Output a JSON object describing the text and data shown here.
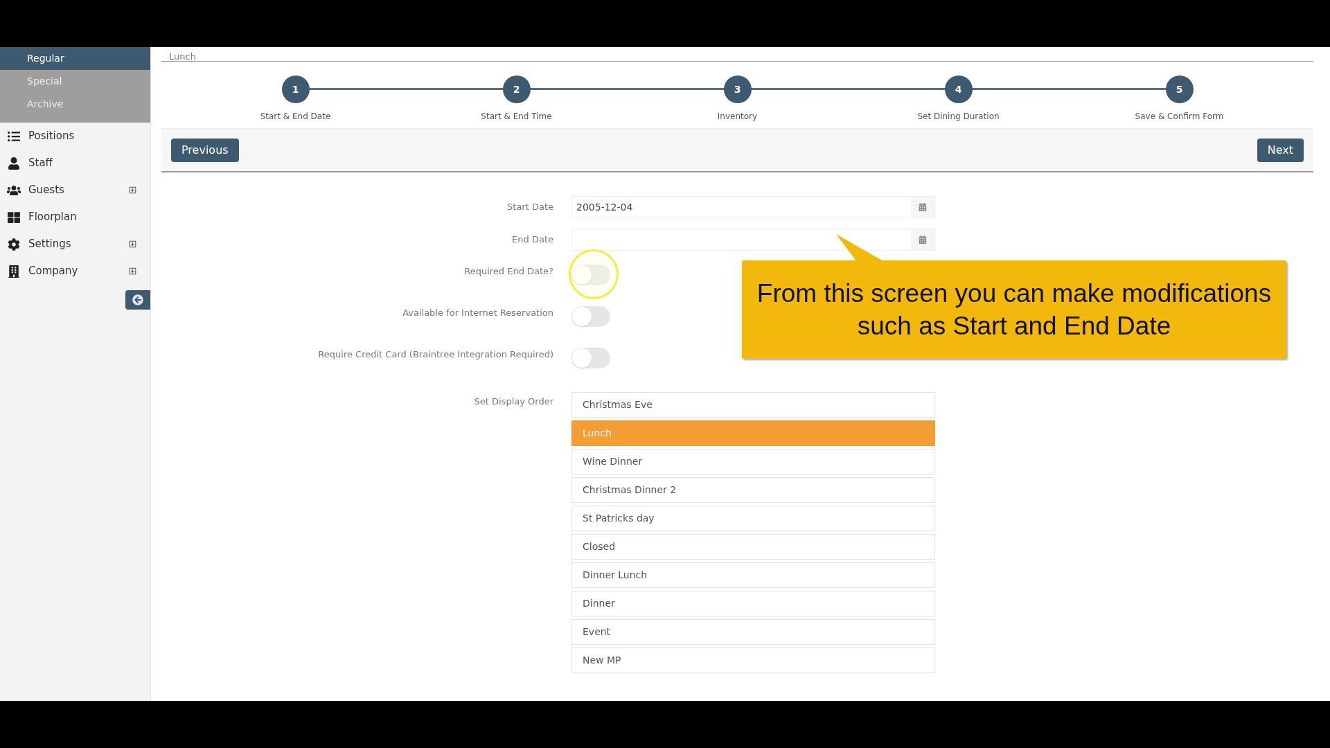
{
  "sidebar": {
    "submenu": [
      {
        "label": "Regular",
        "selected": true
      },
      {
        "label": "Special",
        "selected": false
      },
      {
        "label": "Archive",
        "selected": false
      }
    ],
    "items": [
      {
        "label": "Positions",
        "expandable": false
      },
      {
        "label": "Staff",
        "expandable": false
      },
      {
        "label": "Guests",
        "expandable": true
      },
      {
        "label": "Floorplan",
        "expandable": false
      },
      {
        "label": "Settings",
        "expandable": true
      },
      {
        "label": "Company",
        "expandable": true
      }
    ]
  },
  "breadcrumb": "Lunch",
  "steps": [
    {
      "number": "1",
      "label": "Start & End Date"
    },
    {
      "number": "2",
      "label": "Start & End Time"
    },
    {
      "number": "3",
      "label": "Inventory"
    },
    {
      "number": "4",
      "label": "Set Dining Duration"
    },
    {
      "number": "5",
      "label": "Save & Confirm Form"
    }
  ],
  "buttons": {
    "previous": "Previous",
    "next": "Next"
  },
  "form": {
    "start_date": {
      "label": "Start Date",
      "value": "2005-12-04"
    },
    "end_date": {
      "label": "End Date"
    },
    "toggles": [
      {
        "label": "Required End Date?",
        "on": false,
        "highlighted": true
      },
      {
        "label": "Available for Internet Reservation",
        "on": false,
        "highlighted": false
      },
      {
        "label": "Require Credit Card (Braintree Integration Required)",
        "on": false,
        "highlighted": false
      }
    ],
    "display_order": {
      "label": "Set Display Order",
      "items": [
        {
          "label": "Christmas Eve",
          "selected": false
        },
        {
          "label": "Lunch",
          "selected": true
        },
        {
          "label": "Wine Dinner",
          "selected": false
        },
        {
          "label": "Christmas Dinner 2",
          "selected": false
        },
        {
          "label": "St Patricks day",
          "selected": false
        },
        {
          "label": "Closed",
          "selected": false
        },
        {
          "label": "Dinner Lunch",
          "selected": false
        },
        {
          "label": "Dinner",
          "selected": false
        },
        {
          "label": "Event",
          "selected": false
        },
        {
          "label": "New MP",
          "selected": false
        }
      ]
    }
  },
  "callout": "From this screen you can make modifications such as Start and End Date"
}
